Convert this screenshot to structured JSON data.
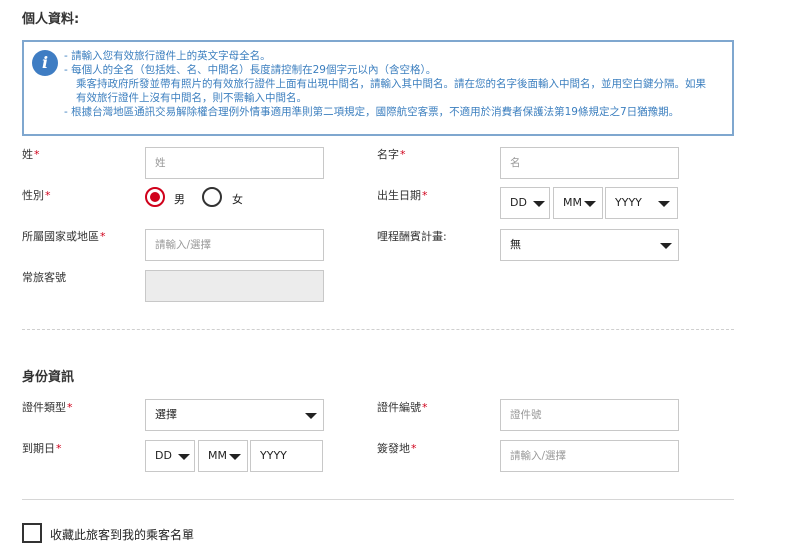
{
  "personal": {
    "section_title": "個人資料:",
    "info_lines": [
      "- 請輸入您有效旅行證件上的英文字母全名。",
      "- 每個人的全名（包括姓、名、中間名）長度請控制在29個字元以內（含空格）。",
      "乘客持政府所發並帶有照片的有效旅行證件上面有出現中間名，請輸入其中間名。請在您的名字後面輸入中間名，並用空白鍵分隔。如果",
      "有效旅行證件上沒有中間名，則不需輸入中間名。",
      "- 根據台灣地區通訊交易解除權合理例外情事適用準則第二項規定，國際航空客票，不適用於消費者保護法第19條規定之7日猶豫期。"
    ],
    "info_icon_glyph": "i",
    "surname_label": "姓",
    "surname_placeholder": "姓",
    "given_label": "名字",
    "given_placeholder": "名",
    "gender_label": "性別",
    "gender_male": "男",
    "gender_female": "女",
    "gender_selected": "男",
    "dob_label": "出生日期",
    "dob_day": "DD",
    "dob_month": "MM",
    "dob_year": "YYYY",
    "country_label": "所屬國家或地區",
    "country_placeholder": "請輸入/選擇",
    "mileage_label": "哩程酬賓計畫:",
    "mileage_value": "無",
    "frequent_flyer_label": "常旅客號",
    "required_mark": "*"
  },
  "identity": {
    "section_title": "身份資訊",
    "doc_type_label": "證件類型",
    "doc_type_value": "選擇",
    "doc_number_label": "證件編號",
    "doc_number_placeholder": "證件號",
    "expiry_label": "到期日",
    "expiry_day": "DD",
    "expiry_month": "MM",
    "expiry_year": "YYYY",
    "issue_place_label": "簽發地",
    "issue_place_placeholder": "請輸入/選擇"
  },
  "save_passenger": {
    "label": "收藏此旅客到我的乘客名單",
    "checked": false
  },
  "colors": {
    "accent_red": "#d0011b",
    "info_blue": "#3c7fbf",
    "info_border": "#7fa7cf"
  }
}
